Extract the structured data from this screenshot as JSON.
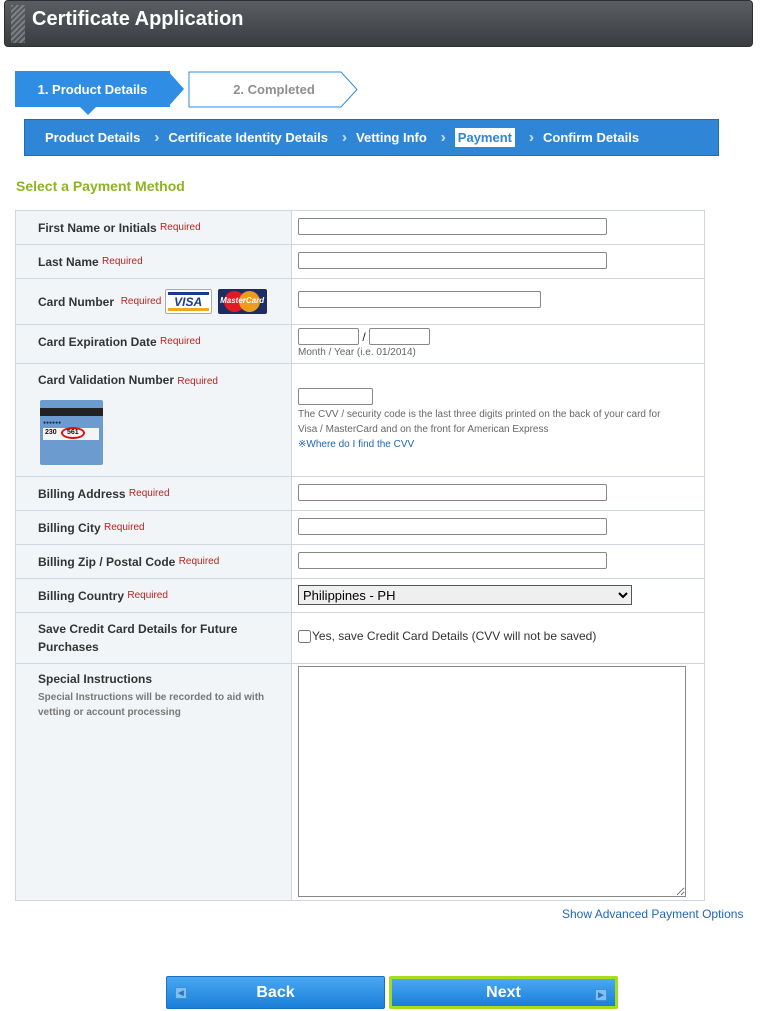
{
  "header": {
    "title": "Certificate Application"
  },
  "steps": [
    {
      "label": "1. Product Details",
      "active": true
    },
    {
      "label": "2. Completed",
      "active": false
    }
  ],
  "breadcrumbs": [
    {
      "label": "Product Details"
    },
    {
      "label": "Certificate Identity Details"
    },
    {
      "label": "Vetting Info"
    },
    {
      "label": "Payment"
    },
    {
      "label": "Confirm Details"
    }
  ],
  "section_title": "Select a Payment Method",
  "required_label": "Required",
  "form": {
    "first_name": {
      "label": "First Name or Initials",
      "value": ""
    },
    "last_name": {
      "label": "Last Name",
      "value": ""
    },
    "card_number": {
      "label": "Card Number",
      "value": "",
      "visa": "VISA",
      "mastercard": "MasterCard"
    },
    "expiration": {
      "label": "Card Expiration Date",
      "month": "",
      "year": "",
      "separator": "/",
      "hint": "Month / Year (i.e. 01/2014)"
    },
    "cvv": {
      "label": "Card Validation Number",
      "value": "",
      "help_line1": "The CVV / security code is the last three digits printed on the back of your card for",
      "help_line2": "Visa / MasterCard and on the front for American Express",
      "help_link": "※Where do I find the CVV",
      "card_digits": "230",
      "card_code": "561"
    },
    "billing_address": {
      "label": "Billing Address",
      "value": ""
    },
    "billing_city": {
      "label": "Billing City",
      "value": ""
    },
    "billing_zip": {
      "label": "Billing Zip / Postal Code",
      "value": ""
    },
    "billing_country": {
      "label": "Billing Country",
      "selected": "Philippines - PH"
    },
    "save_card": {
      "label": "Save Credit Card Details for Future Purchases",
      "option": "Yes, save Credit Card Details (CVV will not be saved)",
      "checked": false
    },
    "special": {
      "label": "Special Instructions",
      "sub": "Special Instructions will be recorded to aid with vetting or account processing",
      "value": ""
    }
  },
  "advanced_link": "Show Advanced Payment Options",
  "buttons": {
    "back": "Back",
    "next": "Next"
  },
  "colors": {
    "accent": "#2f86d6",
    "section": "#8db522",
    "required": "#b22222",
    "next_border": "#a6dc1c"
  }
}
